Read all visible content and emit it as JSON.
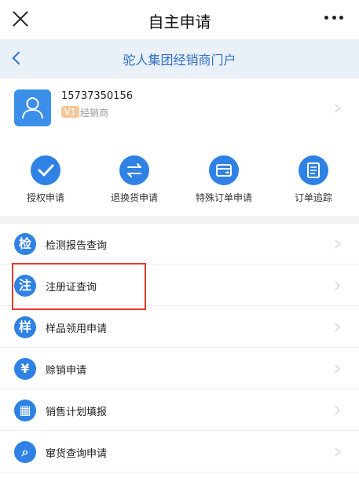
{
  "topbar": {
    "title": "自主申请"
  },
  "navbar": {
    "title": "驼人集团经销商门户"
  },
  "profile": {
    "phone": "15737350156",
    "level": "V1",
    "role": "经销商"
  },
  "actions": [
    {
      "label": "授权申请",
      "icon": "check-icon"
    },
    {
      "label": "退换货申请",
      "icon": "swap-icon"
    },
    {
      "label": "特殊订单申请",
      "icon": "card-icon"
    },
    {
      "label": "订单追踪",
      "icon": "document-icon"
    }
  ],
  "menu": [
    {
      "label": "检测报告查询",
      "icon_char": "检"
    },
    {
      "label": "注册证查询",
      "icon_char": "注"
    },
    {
      "label": "样品领用申请",
      "icon_char": "样"
    },
    {
      "label": "赊销申请",
      "icon_char": "¥"
    },
    {
      "label": "销售计划填报",
      "icon_char": "▦"
    },
    {
      "label": "窜货查询申请",
      "icon_char": "⌕"
    }
  ]
}
